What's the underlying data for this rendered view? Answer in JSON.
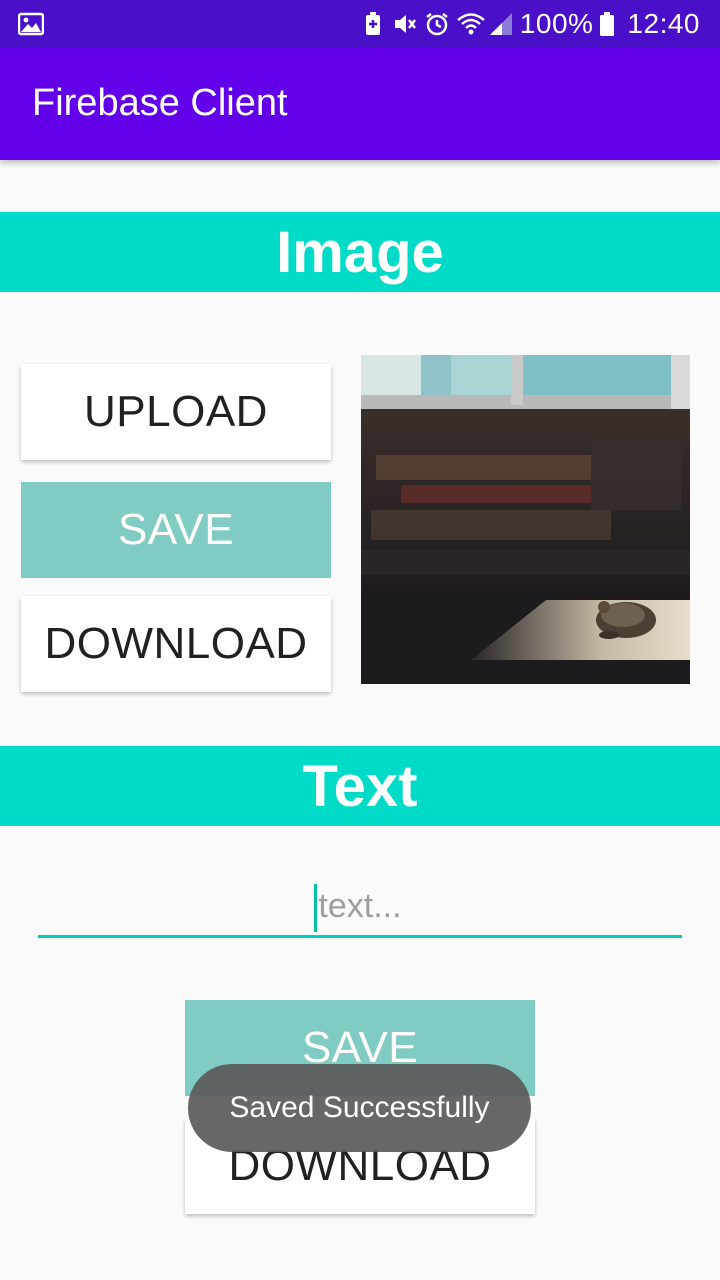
{
  "status_bar": {
    "battery": "100%",
    "time": "12:40",
    "icons": [
      "gallery-icon",
      "battery-saver-icon",
      "mute-icon",
      "alarm-icon",
      "wifi-icon",
      "signal-icon",
      "battery-icon"
    ]
  },
  "app_bar": {
    "title": "Firebase Client"
  },
  "image_section": {
    "header": "Image",
    "upload_label": "UPLOAD",
    "save_label": "SAVE",
    "download_label": "DOWNLOAD"
  },
  "text_section": {
    "header": "Text",
    "input_value": "",
    "input_placeholder": "text...",
    "save_label": "SAVE",
    "download_label": "DOWNLOAD"
  },
  "toast": {
    "message": "Saved Successfully"
  },
  "colors": {
    "status_bar": "#4a0fc9",
    "app_bar": "#6200ea",
    "section_header": "#00dbc7",
    "teal_button": "#80cbc4",
    "input_underline": "#00d1bf"
  }
}
